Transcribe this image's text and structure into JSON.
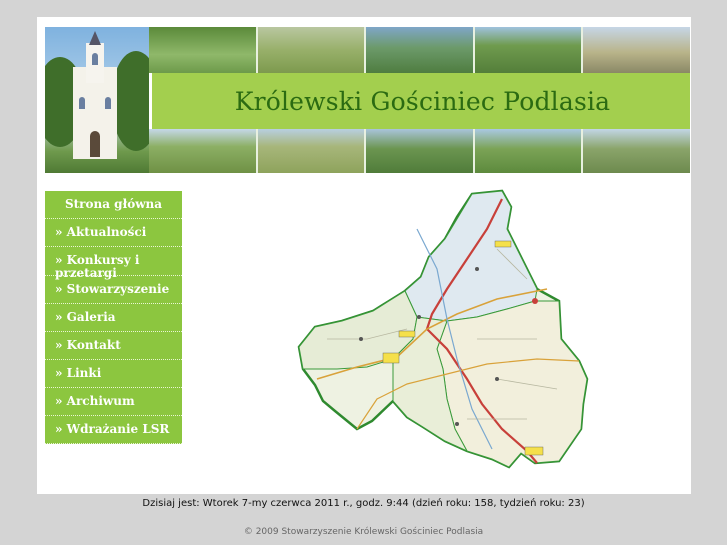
{
  "header": {
    "title": "Królewski Gościniec Podlasia"
  },
  "nav": {
    "items": [
      {
        "label": "Strona główna"
      },
      {
        "label": "» Aktualności"
      },
      {
        "label": "» Konkursy i przetargi"
      },
      {
        "label": "» Stowarzyszenie"
      },
      {
        "label": "» Galeria"
      },
      {
        "label": "» Kontakt"
      },
      {
        "label": "» Linki"
      },
      {
        "label": "» Archiwum"
      },
      {
        "label": "» Wdrażanie LSR"
      }
    ]
  },
  "map": {
    "icon": "region-map-icon"
  },
  "footer": {
    "date_text": "Dzisiaj jest: Wtorek 7-my czerwca 2011 r., godz. 9:44 (dzień roku: 158, tydzień roku: 23)",
    "copyright": "© 2009 Stowarzyszenie Królewski Gościniec Podlasia"
  },
  "colors": {
    "banner": "#a3cf4e",
    "title": "#2b6b12",
    "nav": "#8cc63f",
    "background": "#d4d4d4"
  }
}
